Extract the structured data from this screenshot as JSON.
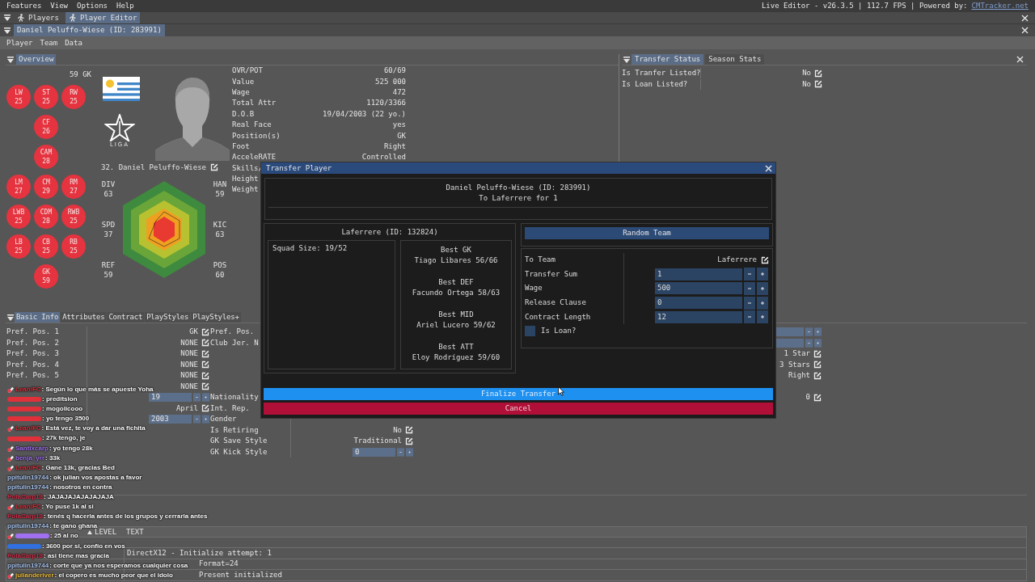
{
  "menu_bar": {
    "items": [
      "Features",
      "View",
      "Options",
      "Help"
    ],
    "status": "Live Editor - v26.3.5 | 112.7 FPS | Powered by:",
    "link": "CMTracker.net"
  },
  "window_tabs": [
    {
      "label": "Players",
      "selected": false
    },
    {
      "label": "Player Editor",
      "selected": true
    }
  ],
  "player_tab": {
    "label": "Daniel Peluffo-Wiese (ID: 283991)",
    "selected": true
  },
  "editor_menu": [
    "Player",
    "Team",
    "Data"
  ],
  "overview": {
    "tab": "Overview",
    "rating": "59 GK",
    "league_logo_text": "LIGA",
    "player_name": "32. Daniel Peluffo-Wiese",
    "position_rows": [
      [
        {
          "label": "LW",
          "rating": "25"
        },
        {
          "label": "ST",
          "rating": "25"
        },
        {
          "label": "RW",
          "rating": "25"
        }
      ],
      [
        null,
        {
          "label": "CF",
          "rating": "26"
        },
        null
      ],
      [
        null,
        {
          "label": "CAM",
          "rating": "28"
        },
        null
      ],
      [
        {
          "label": "LM",
          "rating": "27"
        },
        {
          "label": "CM",
          "rating": "29"
        },
        {
          "label": "RM",
          "rating": "27"
        }
      ],
      [
        {
          "label": "LWB",
          "rating": "25"
        },
        {
          "label": "CDM",
          "rating": "28"
        },
        {
          "label": "RWB",
          "rating": "25"
        }
      ],
      [
        {
          "label": "LB",
          "rating": "25"
        },
        {
          "label": "CB",
          "rating": "25"
        },
        {
          "label": "RB",
          "rating": "25"
        }
      ],
      [
        null,
        {
          "label": "GK",
          "rating": "59"
        },
        null
      ]
    ],
    "radar": [
      {
        "label": "DIV",
        "value": "63"
      },
      {
        "label": "HAN",
        "value": "59"
      },
      {
        "label": "SPD",
        "value": "37"
      },
      {
        "label": "KIC",
        "value": "63"
      },
      {
        "label": "REF",
        "value": "59"
      },
      {
        "label": "POS",
        "value": "60"
      }
    ],
    "stats": [
      {
        "label": "OVR/POT",
        "value": "60/69"
      },
      {
        "label": "Value",
        "value": "525 000"
      },
      {
        "label": "Wage",
        "value": "472"
      },
      {
        "label": "Total Attr",
        "value": "1120/3366"
      },
      {
        "label": "D.O.B",
        "value": "19/04/2003 (22 yo.)"
      },
      {
        "label": "Real Face",
        "value": "yes"
      },
      {
        "label": "Position(s)",
        "value": "GK"
      },
      {
        "label": "Foot",
        "value": "Right"
      },
      {
        "label": "AcceleRATE",
        "value": "Controlled"
      },
      {
        "label": "Skills/"
      },
      {
        "label": "Height"
      },
      {
        "label": "Weight"
      }
    ]
  },
  "transfer_panel": {
    "tabs": [
      {
        "label": "Transfer Status",
        "selected": true
      },
      {
        "label": "Season Stats",
        "selected": false
      }
    ],
    "rows": [
      {
        "label": "Is Tranfer Listed?",
        "value": "No"
      },
      {
        "label": "Is Loan Listed?",
        "value": "No"
      }
    ]
  },
  "details": {
    "tabs": [
      {
        "label": "Basic Info",
        "selected": true
      },
      {
        "label": "Attributes",
        "selected": false
      },
      {
        "label": "Contract",
        "selected": false
      },
      {
        "label": "PlayStyles",
        "selected": false
      },
      {
        "label": "PlayStyles+",
        "selected": false
      }
    ],
    "columns": [
      [
        {
          "kind": "edit",
          "label": "Pref. Pos. 1",
          "value": "GK"
        },
        {
          "kind": "edit",
          "label": "Pref. Pos. 2",
          "value": "NONE"
        },
        {
          "kind": "edit",
          "label": "Pref. Pos. 3",
          "value": "NONE"
        },
        {
          "kind": "edit",
          "label": "Pref. Pos. 4",
          "value": "NONE"
        },
        {
          "kind": "edit",
          "label": "Pref. Pos. 5",
          "value": "NONE"
        },
        {
          "kind": "edit",
          "value": "NONE"
        },
        {
          "kind": "spinner",
          "value": "19"
        },
        {
          "kind": "edit",
          "value": "April"
        },
        {
          "kind": "spinner",
          "value": "2003"
        }
      ],
      [
        {
          "kind": "label",
          "label": "Pref. Pos."
        },
        {
          "kind": "label",
          "label": "Club Jer. N"
        },
        {
          "kind": "empty"
        },
        {
          "kind": "empty"
        },
        {
          "kind": "empty"
        },
        {
          "kind": "empty"
        },
        {
          "kind": "label",
          "label": "Nationality"
        },
        {
          "kind": "label",
          "label": "Int. Rep."
        },
        {
          "kind": "label",
          "label": "Gender"
        },
        {
          "kind": "edit",
          "label": "Is Retiring",
          "value": "No"
        },
        {
          "kind": "edit",
          "label": "GK Save Style",
          "value": "Traditional"
        },
        {
          "kind": "spinner",
          "label": "GK Kick Style",
          "value": "0"
        }
      ],
      [
        {
          "kind": "spinner"
        },
        {
          "kind": "spinner"
        },
        {
          "kind": "edit",
          "value": "1 Star"
        },
        {
          "kind": "edit",
          "value": "3 Stars"
        },
        {
          "kind": "edit",
          "value": "Right"
        },
        {
          "kind": "empty"
        },
        {
          "kind": "edit",
          "value": "0"
        }
      ]
    ]
  },
  "logger": {
    "columns": [
      "LEVEL",
      "TEXT"
    ],
    "rows": [
      {
        "kind": "full",
        "text": "DirectX12 - Initialize attempt: 1"
      },
      {
        "kind": "tail",
        "text": "Format=24"
      },
      {
        "kind": "tail",
        "text": "Present initialized"
      }
    ]
  },
  "transfer_dialog": {
    "title": "Transfer Player",
    "summary": [
      "Daniel Peluffo-Wiese (ID: 283991)",
      "To Laferrere for 1"
    ],
    "team_title": "Laferrere (ID: 132824)",
    "squad_size": "Squad Size: 19/52",
    "best": [
      {
        "label": "Best GK",
        "player": "Tiago Libares 56/66"
      },
      {
        "label": "Best DEF",
        "player": "Facundo Ortega 58/63"
      },
      {
        "label": "Best MID",
        "player": "Ariel Lucero 59/62"
      },
      {
        "label": "Best ATT",
        "player": "Eloy Rodríguez 59/60"
      }
    ],
    "random_button": "Random Team",
    "fields": [
      {
        "kind": "edit",
        "label": "To Team",
        "value": "Laferrere"
      },
      {
        "kind": "spinner",
        "label": "Transfer Sum",
        "value": "1"
      },
      {
        "kind": "spinner",
        "label": "Wage",
        "value": "500"
      },
      {
        "kind": "spinner",
        "label": "Release Clause",
        "value": "0"
      },
      {
        "kind": "spinner",
        "label": "Contract Length",
        "value": "12"
      },
      {
        "kind": "checkbox",
        "label": "Is Loan?",
        "checked": false
      }
    ],
    "finalize_button": "Finalize Transfer",
    "cancel_button": "Cancel"
  },
  "chat": [
    {
      "user": "LeaniFC",
      "color": "#e0303a",
      "badge": true,
      "text": ": Según lo que más se apueste Yoha"
    },
    {
      "color": "#e0303a",
      "badge": false,
      "text": ": preditsion"
    },
    {
      "color": "#e0303a",
      "badge": false,
      "text": ": mogolicooo"
    },
    {
      "color": "#e0303a",
      "badge": false,
      "text": ": yo tengo 3500"
    },
    {
      "user": "LeaniFC",
      "color": "#e0303a",
      "badge": true,
      "text": ": Está vez, te voy a dar una fichita"
    },
    {
      "color": "#e0303a",
      "badge": false,
      "text": ": 27k tengo, je"
    },
    {
      "user": "Santixcarp",
      "color": "#a070f0",
      "badge": true,
      "text": ": yo tengo 28k"
    },
    {
      "user": "benja_yrr",
      "color": "#a070f0",
      "badge": true,
      "text": ": 33k"
    },
    {
      "user": "LeaniFC",
      "color": "#e0303a",
      "badge": true,
      "text": ": Gane 13k, gracias Bed"
    },
    {
      "user": "ppitulin19744",
      "color": "#a8c4f0",
      "badge": false,
      "text": ": ok julian vos apostas a favor"
    },
    {
      "user": "ppitulin19744",
      "color": "#a8c4f0",
      "badge": false,
      "text": ": nosotros en contra"
    },
    {
      "user": "PolaCarp18",
      "color": "#d0304a",
      "badge": false,
      "text": ": JAJAJAJAJAJAJAJA"
    },
    {
      "user": "LeaniFC",
      "color": "#e0303a",
      "badge": true,
      "text": ": Yo puse 1k al si"
    },
    {
      "user": "PolaCarp18",
      "color": "#d0304a",
      "badge": false,
      "text": ": tenés q hacerla antes de los grupos y cerrarla antes"
    },
    {
      "user": "ppitulin19744",
      "color": "#a8c4f0",
      "badge": false,
      "text": ": te gano ghana"
    },
    {
      "color": "#a070f0",
      "badge": true,
      "text": ": 25 al no"
    },
    {
      "color": "#3070e0",
      "badge": false,
      "text": ": 3600 por si, confio en vos"
    },
    {
      "user": "PolaCarp18",
      "color": "#d0304a",
      "badge": false,
      "text": ": asi tiene mas gracia"
    },
    {
      "user": "ppitulin19744",
      "color": "#a8c4f0",
      "badge": false,
      "text": ": corte que ya nos esperamos cualquier cosa"
    },
    {
      "user": "julianderiver",
      "color": "#f0c040",
      "badge": true,
      "text": ": el copero es mucho peor que el idolo"
    }
  ]
}
